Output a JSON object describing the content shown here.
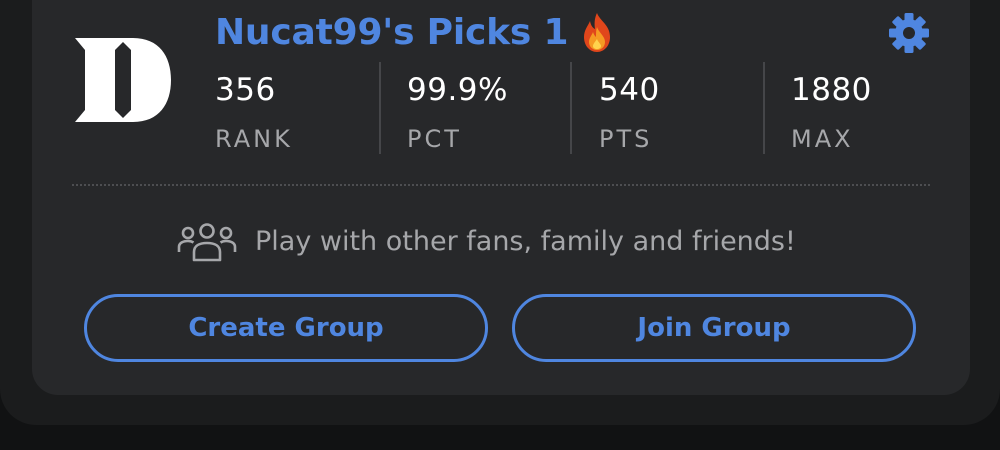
{
  "header": {
    "team_logo": "duke-d-logo",
    "title": "Nucat99's Picks 1",
    "title_icon": "fire-icon",
    "settings_icon": "gear-icon",
    "accent_color": "#4f86e0"
  },
  "stats": [
    {
      "value": "356",
      "label": "RANK"
    },
    {
      "value": "99.9%",
      "label": "PCT"
    },
    {
      "value": "540",
      "label": "PTS"
    },
    {
      "value": "1880",
      "label": "MAX"
    }
  ],
  "invite": {
    "icon": "group-people-icon",
    "text": "Play with other fans, family and friends!"
  },
  "actions": {
    "create_label": "Create Group",
    "join_label": "Join Group"
  }
}
